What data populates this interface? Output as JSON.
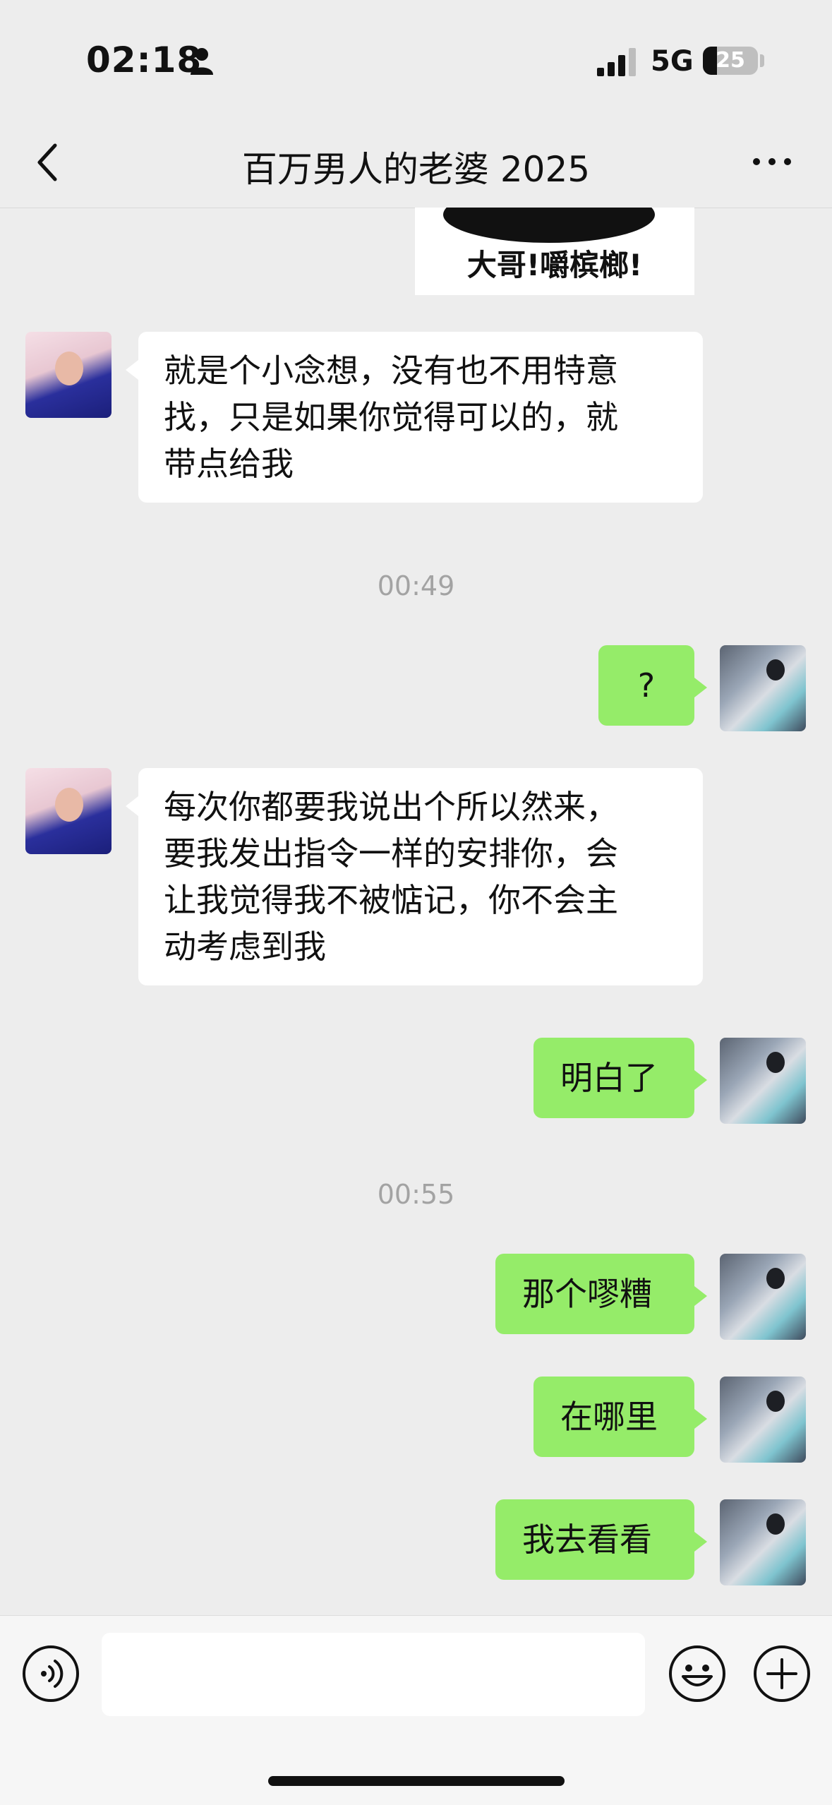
{
  "status_bar": {
    "time": "02:18",
    "network": "5G",
    "battery": "25",
    "battery_level": 0.25
  },
  "nav": {
    "title": "百万男人的老婆 2025"
  },
  "sticker": {
    "caption": "大哥!嚼槟榔!"
  },
  "messages": [
    {
      "from": "them",
      "text": "就是个小念想，没有也不用特意\n找，只是如果你觉得可以的，就\n带点给我"
    },
    {
      "timestamp": "00:49"
    },
    {
      "from": "me",
      "text": "?"
    },
    {
      "from": "them",
      "text": "每次你都要我说出个所以然来，\n要我发出指令一样的安排你，会\n让我觉得我不被惦记，你不会主\n动考虑到我"
    },
    {
      "from": "me",
      "text": "明白了"
    },
    {
      "timestamp": "00:55"
    },
    {
      "from": "me",
      "text": "那个嘐糟"
    },
    {
      "from": "me",
      "text": "在哪里"
    },
    {
      "from": "me",
      "text": "我去看看"
    }
  ],
  "input": {
    "value": "",
    "placeholder": ""
  },
  "colors": {
    "background": "#ededed",
    "outgoing_bubble": "#95ec69",
    "incoming_bubble": "#ffffff",
    "timestamp": "#a3a3a3"
  },
  "icons": {
    "back": "chevron-left-icon",
    "more": "more-dots-icon",
    "voice": "voice-icon",
    "emoji": "emoji-icon",
    "plus": "plus-icon"
  }
}
